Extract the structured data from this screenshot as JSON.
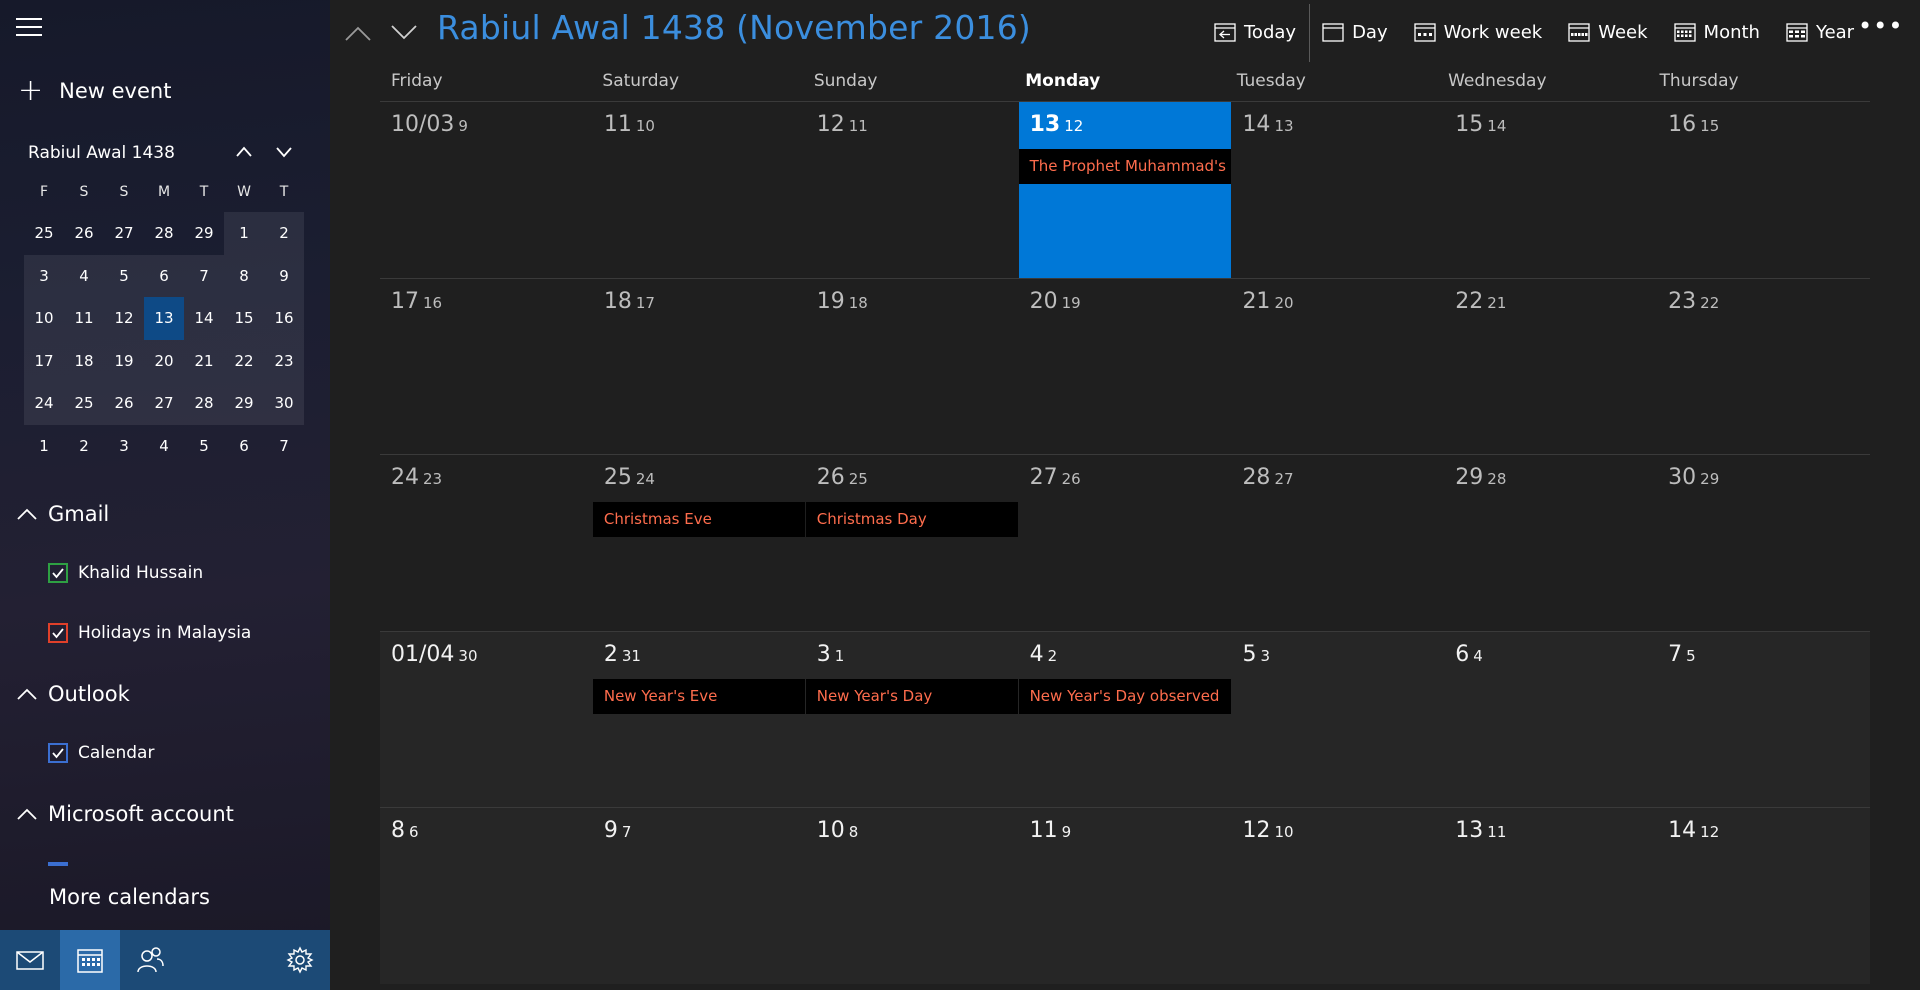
{
  "sidebar": {
    "new_event_label": "New event",
    "mini_title": "Rabiul Awal 1438",
    "dow": [
      "F",
      "S",
      "S",
      "M",
      "T",
      "W",
      "T"
    ],
    "weeks": [
      [
        {
          "n": "25",
          "in": false
        },
        {
          "n": "26",
          "in": false
        },
        {
          "n": "27",
          "in": false
        },
        {
          "n": "28",
          "in": false
        },
        {
          "n": "29",
          "in": false
        },
        {
          "n": "1",
          "in": true
        },
        {
          "n": "2",
          "in": true
        }
      ],
      [
        {
          "n": "3",
          "in": true
        },
        {
          "n": "4",
          "in": true
        },
        {
          "n": "5",
          "in": true
        },
        {
          "n": "6",
          "in": true
        },
        {
          "n": "7",
          "in": true
        },
        {
          "n": "8",
          "in": true
        },
        {
          "n": "9",
          "in": true
        }
      ],
      [
        {
          "n": "10",
          "in": true
        },
        {
          "n": "11",
          "in": true
        },
        {
          "n": "12",
          "in": true
        },
        {
          "n": "13",
          "in": true,
          "sel": true
        },
        {
          "n": "14",
          "in": true
        },
        {
          "n": "15",
          "in": true
        },
        {
          "n": "16",
          "in": true
        }
      ],
      [
        {
          "n": "17",
          "in": true
        },
        {
          "n": "18",
          "in": true
        },
        {
          "n": "19",
          "in": true
        },
        {
          "n": "20",
          "in": true
        },
        {
          "n": "21",
          "in": true
        },
        {
          "n": "22",
          "in": true
        },
        {
          "n": "23",
          "in": true
        }
      ],
      [
        {
          "n": "24",
          "in": true
        },
        {
          "n": "25",
          "in": true
        },
        {
          "n": "26",
          "in": true
        },
        {
          "n": "27",
          "in": true
        },
        {
          "n": "28",
          "in": true
        },
        {
          "n": "29",
          "in": true
        },
        {
          "n": "30",
          "in": true
        }
      ],
      [
        {
          "n": "1",
          "in": false
        },
        {
          "n": "2",
          "in": false
        },
        {
          "n": "3",
          "in": false
        },
        {
          "n": "4",
          "in": false
        },
        {
          "n": "5",
          "in": false
        },
        {
          "n": "6",
          "in": false
        },
        {
          "n": "7",
          "in": false
        }
      ]
    ],
    "groups": {
      "gmail": "Gmail",
      "outlook": "Outlook",
      "microsoft": "Microsoft account"
    },
    "calendars": {
      "khalid": {
        "label": "Khalid Hussain",
        "color": "#2ea043"
      },
      "malaysia": {
        "label": "Holidays in Malaysia",
        "color": "#e0402a"
      },
      "calendar": {
        "label": "Calendar",
        "color": "#3b6fd1"
      }
    },
    "more_calendars": "More calendars",
    "bottom_icons": [
      "mail-icon",
      "calendar-icon",
      "people-icon",
      "gear-icon"
    ]
  },
  "header": {
    "title": "Rabiul Awal 1438 (November 2016)",
    "toolbar": {
      "today": "Today",
      "day": "Day",
      "work_week": "Work week",
      "week": "Week",
      "month": "Month",
      "year": "Year"
    },
    "more": "•••"
  },
  "grid": {
    "dow": [
      "Friday",
      "Saturday",
      "Sunday",
      "Monday",
      "Tuesday",
      "Wednesday",
      "Thursday"
    ],
    "today_index": 3,
    "weeks": [
      {
        "next_month": false,
        "days": [
          {
            "g": "10/03",
            "h": "9"
          },
          {
            "g": "11",
            "h": "10"
          },
          {
            "g": "12",
            "h": "11"
          },
          {
            "g": "13",
            "h": "12",
            "today": true,
            "event": "The Prophet Muhammad's Birthday"
          },
          {
            "g": "14",
            "h": "13"
          },
          {
            "g": "15",
            "h": "14"
          },
          {
            "g": "16",
            "h": "15"
          }
        ]
      },
      {
        "next_month": false,
        "days": [
          {
            "g": "17",
            "h": "16"
          },
          {
            "g": "18",
            "h": "17"
          },
          {
            "g": "19",
            "h": "18"
          },
          {
            "g": "20",
            "h": "19"
          },
          {
            "g": "21",
            "h": "20"
          },
          {
            "g": "22",
            "h": "21"
          },
          {
            "g": "23",
            "h": "22"
          }
        ]
      },
      {
        "next_month": false,
        "days": [
          {
            "g": "24",
            "h": "23"
          },
          {
            "g": "25",
            "h": "24",
            "event": "Christmas Eve"
          },
          {
            "g": "26",
            "h": "25",
            "event": "Christmas Day"
          },
          {
            "g": "27",
            "h": "26"
          },
          {
            "g": "28",
            "h": "27"
          },
          {
            "g": "29",
            "h": "28"
          },
          {
            "g": "30",
            "h": "29"
          }
        ]
      },
      {
        "next_month": true,
        "days": [
          {
            "g": "01/04",
            "h": "30"
          },
          {
            "g": "2",
            "h": "31",
            "event": "New Year's Eve"
          },
          {
            "g": "3",
            "h": "1",
            "event": "New Year's Day"
          },
          {
            "g": "4",
            "h": "2",
            "event": "New Year's Day observed"
          },
          {
            "g": "5",
            "h": "3"
          },
          {
            "g": "6",
            "h": "4"
          },
          {
            "g": "7",
            "h": "5"
          }
        ]
      },
      {
        "next_month": true,
        "days": [
          {
            "g": "8",
            "h": "6"
          },
          {
            "g": "9",
            "h": "7"
          },
          {
            "g": "10",
            "h": "8"
          },
          {
            "g": "11",
            "h": "9"
          },
          {
            "g": "12",
            "h": "10"
          },
          {
            "g": "13",
            "h": "11"
          },
          {
            "g": "14",
            "h": "12"
          }
        ]
      }
    ]
  },
  "colors": {
    "accent": "#0078d7",
    "title": "#3b8ede",
    "event_text": "#ff6d4d"
  }
}
